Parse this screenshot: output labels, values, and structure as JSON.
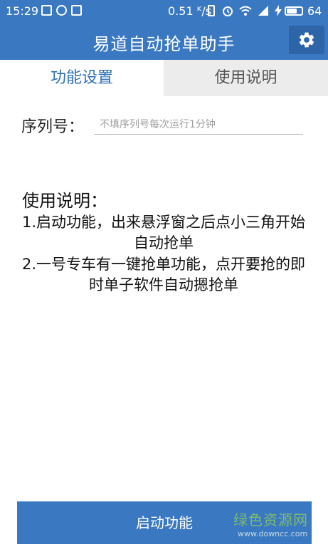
{
  "status_bar": {
    "time": "15:29",
    "net_speed": "0.51 ᴷ/s",
    "battery_level": "64",
    "battery_fraction": 0.64,
    "icons_left": [
      "image-icon",
      "check-circle-icon",
      "notification-icon"
    ],
    "icons_right": [
      "vibrate-icon",
      "alarm-icon",
      "wifi-icon",
      "signal-icon",
      "charging-icon",
      "battery-icon"
    ]
  },
  "app_bar": {
    "title": "易道自动抢单助手",
    "settings_icon": "gear-icon"
  },
  "tabs": [
    {
      "label": "功能设置",
      "selected": true
    },
    {
      "label": "使用说明",
      "selected": false
    }
  ],
  "serial": {
    "label": "序列号：",
    "value": "",
    "placeholder": "不填序列号每次运行1分钟"
  },
  "instructions": {
    "title": "使用说明：",
    "items": [
      "1.启动功能，出来悬浮窗之后点小三角开始自动抢单",
      "2.一号专车有一键抢单功能，点开要抢的即时单子软件自动摁抢单"
    ]
  },
  "start_button": {
    "label": "启动功能"
  },
  "watermark": {
    "text": "绿色资源网",
    "url": "www.downcc.com"
  },
  "colors": {
    "primary": "#3a78c2",
    "primary_dark": "#2d65a8",
    "tab_active_text": "#2f6fb3",
    "tab_inactive_bg": "#ececec"
  }
}
